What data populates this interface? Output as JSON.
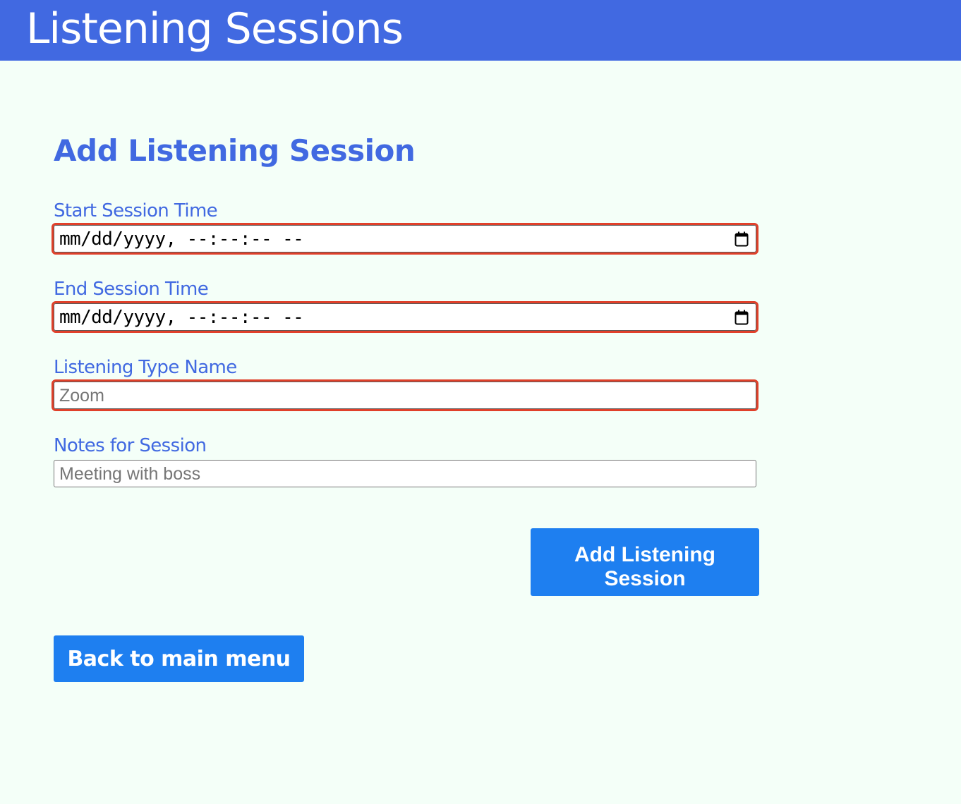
{
  "header": {
    "app_title": "Listening Sessions"
  },
  "form": {
    "heading": "Add Listening Session",
    "start_time": {
      "label": "Start Session Time",
      "value": "mm/dd/yyyy, --:--:-- --"
    },
    "end_time": {
      "label": "End Session Time",
      "value": "mm/dd/yyyy, --:--:-- --"
    },
    "listening_type": {
      "label": "Listening Type Name",
      "placeholder": "Zoom"
    },
    "notes": {
      "label": "Notes for Session",
      "placeholder": "Meeting with boss"
    },
    "submit_label": "Add Listening Session"
  },
  "nav": {
    "back_label": "Back to main menu"
  },
  "colors": {
    "header_bg": "#4169e1",
    "page_bg": "#f4fff8",
    "accent_text": "#4169e1",
    "button_bg": "#1e7ff0",
    "invalid_outline": "#e0402a"
  },
  "icons": {
    "date_picker": "calendar-icon"
  }
}
